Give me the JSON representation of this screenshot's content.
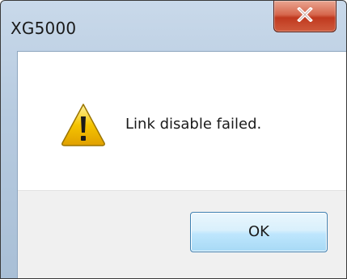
{
  "window": {
    "title": "XG5000"
  },
  "dialog": {
    "message": "Link disable failed.",
    "icon": "warning-icon"
  },
  "buttons": {
    "ok_label": "OK",
    "close_icon": "close-icon"
  },
  "colors": {
    "close_button": "#c0391f",
    "ok_border": "#3c7fb1",
    "warning_yellow": "#f5c400"
  }
}
